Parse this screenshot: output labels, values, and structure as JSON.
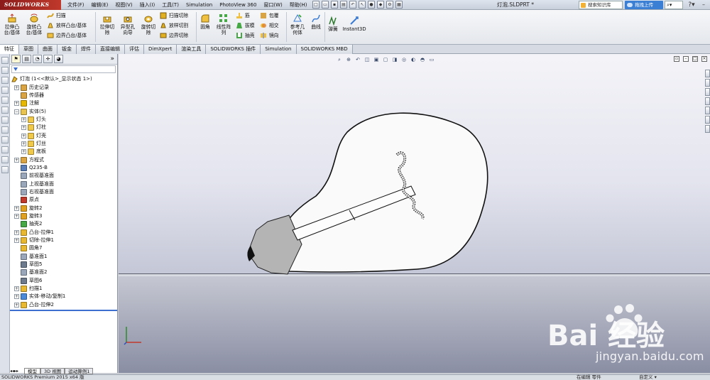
{
  "app": {
    "logo_text": "SOLIDWORKS",
    "document_title": "灯泡.SLDPRT *"
  },
  "menu": [
    "文件(F)",
    "编辑(E)",
    "视图(V)",
    "插入(I)",
    "工具(T)",
    "Simulation",
    "PhotoView 360",
    "窗口(W)",
    "帮助(H)"
  ],
  "topbar": {
    "search_placeholder": "搜索知识库",
    "upload_label": "拖拽上传",
    "search_tool_label": "⌕▾",
    "help_label": "?▾",
    "minimize_label": "–"
  },
  "ribbon": {
    "boss_extrude": "拉伸凸\n台/基体",
    "revolve_boss": "旋转凸\n台/基体",
    "sweep": "扫描",
    "loft_boss": "放样凸台/基体",
    "boundary_boss": "边界凸台/基体",
    "extruded_cut": "拉伸切\n除",
    "hole_wizard": "异型孔\n向导",
    "revolved_cut": "旋转切\n除",
    "swept_cut": "扫描切除",
    "lofted_cut": "放样切割",
    "boundary_cut": "边界切除",
    "fillet": "圆角",
    "linear_pattern": "线性阵\n列",
    "rib": "筋",
    "draft": "拔模",
    "shell": "抽壳",
    "wrap": "包覆",
    "intersect": "相交",
    "mirror": "镜向",
    "ref_geometry": "参考几\n何体",
    "curves": "曲线",
    "freeform": "弹簧",
    "instant3d": "Instant3D"
  },
  "tabs": [
    "特征",
    "草图",
    "曲面",
    "钣金",
    "焊件",
    "直接编辑",
    "评估",
    "DimXpert",
    "渲染工具",
    "SOLIDWORKS 插件",
    "Simulation",
    "SOLIDWORKS MBD"
  ],
  "feature_tree": {
    "root": "灯泡  (1<<默认>_显示状态 1>)",
    "items": [
      {
        "label": "历史记录",
        "level": 1,
        "expander": "+",
        "icon": "history-icon",
        "color": "#d9a441"
      },
      {
        "label": "传感器",
        "level": 1,
        "expander": "",
        "icon": "sensor-icon",
        "color": "#d9a441"
      },
      {
        "label": "注解",
        "level": 1,
        "expander": "+",
        "icon": "annotation-icon",
        "color": "#e6b800"
      },
      {
        "label": "实体(5)",
        "level": 1,
        "expander": "−",
        "icon": "solid-bodies-folder-icon",
        "color": "#e8c350"
      },
      {
        "label": "灯头",
        "level": 2,
        "expander": "+",
        "icon": "solid-body-icon",
        "color": "#f0c84a"
      },
      {
        "label": "灯柱",
        "level": 2,
        "expander": "+",
        "icon": "solid-body-icon",
        "color": "#f0c84a"
      },
      {
        "label": "灯壳",
        "level": 2,
        "expander": "+",
        "icon": "solid-body-icon",
        "color": "#f0c84a"
      },
      {
        "label": "灯丝",
        "level": 2,
        "expander": "+",
        "icon": "solid-body-icon",
        "color": "#f0c84a"
      },
      {
        "label": "底板",
        "level": 2,
        "expander": "+",
        "icon": "solid-body-icon",
        "color": "#f0c84a"
      },
      {
        "label": "方程式",
        "level": 1,
        "expander": "+",
        "icon": "equations-icon",
        "color": "#d9a441"
      },
      {
        "label": "Q235-B",
        "level": 1,
        "expander": "",
        "icon": "material-icon",
        "color": "#5a7fb8"
      },
      {
        "label": "前视基准面",
        "level": 1,
        "expander": "",
        "icon": "plane-icon",
        "color": "#9aa7bb"
      },
      {
        "label": "上视基准面",
        "level": 1,
        "expander": "",
        "icon": "plane-icon",
        "color": "#9aa7bb"
      },
      {
        "label": "右视基准面",
        "level": 1,
        "expander": "",
        "icon": "plane-icon",
        "color": "#9aa7bb"
      },
      {
        "label": "原点",
        "level": 1,
        "expander": "",
        "icon": "origin-icon",
        "color": "#c0392b"
      },
      {
        "label": "旋转2",
        "level": 1,
        "expander": "+",
        "icon": "revolve-icon",
        "color": "#e0a020"
      },
      {
        "label": "旋转3",
        "level": 1,
        "expander": "+",
        "icon": "revolve-icon",
        "color": "#e0a020"
      },
      {
        "label": "抽壳2",
        "level": 1,
        "expander": "",
        "icon": "shell-icon",
        "color": "#45a845"
      },
      {
        "label": "凸台-拉伸1",
        "level": 1,
        "expander": "+",
        "icon": "extrude-icon",
        "color": "#e8b830"
      },
      {
        "label": "切除-拉伸1",
        "level": 1,
        "expander": "+",
        "icon": "cut-extrude-icon",
        "color": "#e8b830"
      },
      {
        "label": "圆角7",
        "level": 1,
        "expander": "",
        "icon": "fillet-icon",
        "color": "#e8b830"
      },
      {
        "label": "基准面1",
        "level": 1,
        "expander": "",
        "icon": "plane-icon",
        "color": "#9aa7bb"
      },
      {
        "label": "草图5",
        "level": 1,
        "expander": "",
        "icon": "sketch-icon",
        "color": "#6d7a8d"
      },
      {
        "label": "基准面2",
        "level": 1,
        "expander": "",
        "icon": "plane-icon",
        "color": "#9aa7bb"
      },
      {
        "label": "草图6",
        "level": 1,
        "expander": "",
        "icon": "sketch-icon",
        "color": "#6d7a8d"
      },
      {
        "label": "扫描1",
        "level": 1,
        "expander": "+",
        "icon": "sweep-icon",
        "color": "#e8b830"
      },
      {
        "label": "实体-移动/复制1",
        "level": 1,
        "expander": "+",
        "icon": "move-copy-icon",
        "color": "#4a8ad8"
      },
      {
        "label": "凸台-拉伸2",
        "level": 1,
        "expander": "+",
        "icon": "extrude-icon",
        "color": "#e8b830"
      }
    ]
  },
  "bottom_tabs": [
    "模型",
    "3D 视图",
    "运动算例1"
  ],
  "status": {
    "left": "SOLIDWORKS Premium 2015 x64 版",
    "mid": "在编辑 零件",
    "right": "自定义 ▾"
  },
  "watermark": {
    "brand": "Bai 经验",
    "url": "jingyan.baidu.com"
  }
}
